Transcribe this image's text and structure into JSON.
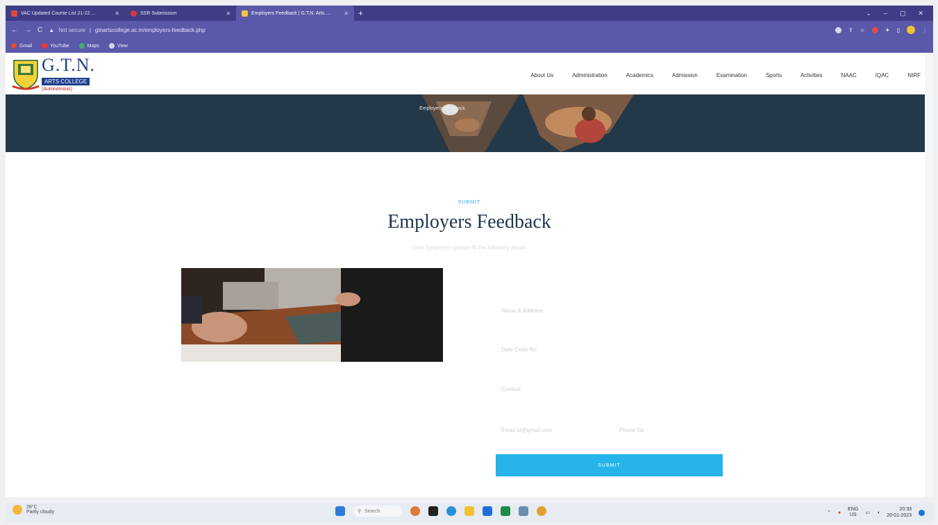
{
  "browser": {
    "tabs": [
      {
        "label": "VAC Updated Course List 21-22 ...",
        "active": false
      },
      {
        "label": "SSR Submission",
        "active": false
      },
      {
        "label": "Employers Feedback | G.T.N. Arts ...",
        "active": true
      }
    ],
    "new_tab": "+",
    "window_controls": {
      "minimize": "–",
      "maximize": "▢",
      "close": "✕"
    },
    "nav": {
      "back": "←",
      "forward": "→",
      "reload": "C"
    },
    "address": {
      "security": "Not secure",
      "url": "gtnartscollege.ac.in/employers-feedback.php"
    },
    "bookmarks": [
      "Gmail",
      "YouTube",
      "Maps",
      "View"
    ]
  },
  "site": {
    "logo": {
      "name": "G.T.N.",
      "college": "ARTS COLLEGE",
      "status": "(Autonomous)"
    },
    "nav": [
      "About Us",
      "Administration",
      "Academics",
      "Admission",
      "Examination",
      "Sports",
      "Activities",
      "NAAC",
      "IQAC",
      "NIRF"
    ],
    "banner_text": "Employers Feedback"
  },
  "content": {
    "eyebrow": "SUBMIT",
    "title": "Employers Feedback",
    "subtitle": "Dear Employers please fill the following details",
    "fields": {
      "name": "Name & Address",
      "date": "Date Code No",
      "contact": "Contact",
      "email": "Email id@gmail.com",
      "phone": "Phone No"
    },
    "submit_label": "SUBMIT"
  },
  "taskbar": {
    "weather": {
      "temp": "28°C",
      "desc": "Partly cloudy"
    },
    "search": "Search",
    "tray": {
      "lang_top": "ENG",
      "lang_bottom": "US",
      "time": "20:33",
      "date": "20-01-2023"
    }
  }
}
